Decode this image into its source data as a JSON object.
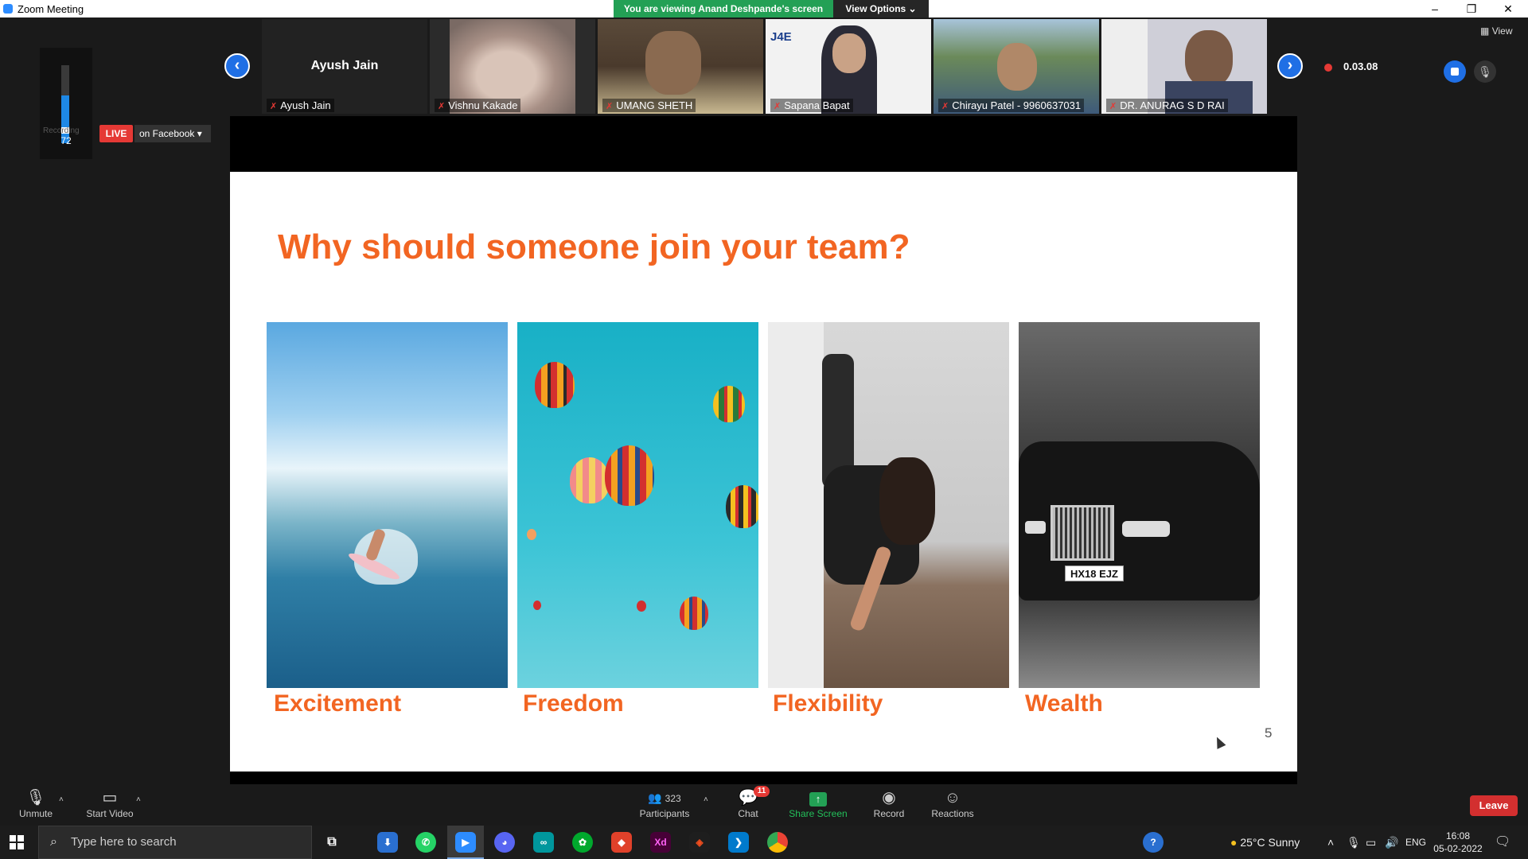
{
  "window": {
    "app_title": "Zoom Meeting",
    "viewing_banner": "You are viewing Anand Deshpande's screen",
    "view_options": "View Options ⌄"
  },
  "strip": {
    "view_label": "View",
    "participants": [
      {
        "display": "Ayush Jain",
        "name": "Ayush Jain"
      },
      {
        "name": "Vishnu Kakade"
      },
      {
        "name": "UMANG SHETH"
      },
      {
        "name": "Sapana Bapat"
      },
      {
        "name": "Chirayu Patel - 9960637031"
      },
      {
        "name": "DR. ANURAG S D RAI"
      }
    ],
    "recording_time": "0.03.08"
  },
  "meter": {
    "value": "72",
    "recording_label": "Recording",
    "level": 0.72
  },
  "live": {
    "badge": "LIVE",
    "platform": "on Facebook"
  },
  "slide": {
    "title": "Why should someone join your team?",
    "captions": [
      "Excitement",
      "Freedom",
      "Flexibility",
      "Wealth"
    ],
    "number": "5",
    "plate": "HX18 EJZ"
  },
  "toolbar": {
    "unmute": "Unmute",
    "start_video": "Start Video",
    "participants_count": "323",
    "participants": "Participants",
    "chat": "Chat",
    "chat_badge": "11",
    "share_screen": "Share Screen",
    "record": "Record",
    "reactions": "Reactions",
    "leave": "Leave"
  },
  "taskbar": {
    "search_placeholder": "Type here to search",
    "weather": "25°C  Sunny",
    "lang": "ENG",
    "time": "16:08",
    "date": "05-02-2022"
  },
  "colors": {
    "accent_orange": "#f26522",
    "zoom_blue": "#1f6fe5",
    "live_red": "#e53935",
    "share_green": "#23a055"
  }
}
